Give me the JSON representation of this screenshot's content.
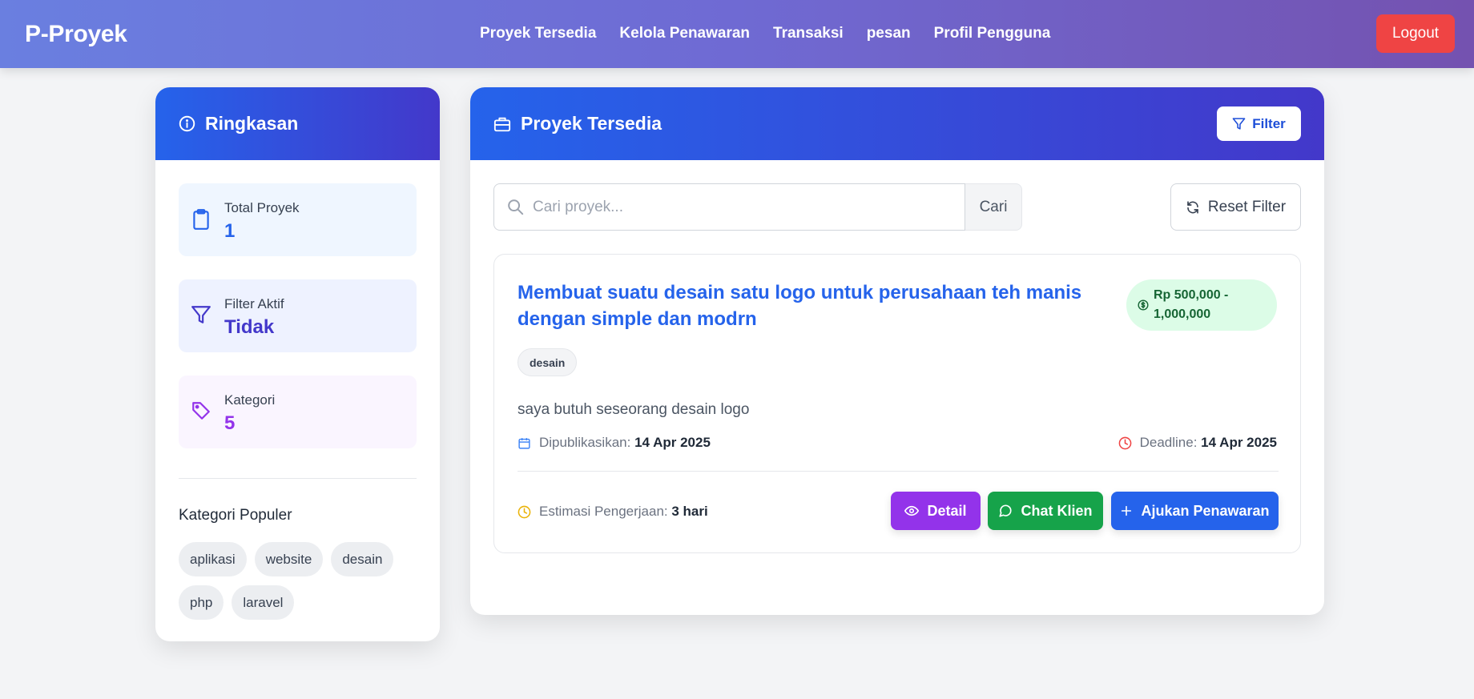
{
  "navbar": {
    "brand": "P-Proyek",
    "links": [
      "Proyek Tersedia",
      "Kelola Penawaran",
      "Transaksi",
      "pesan",
      "Profil Pengguna"
    ],
    "logout_label": "Logout"
  },
  "summary": {
    "title": "Ringkasan",
    "stats": [
      {
        "label": "Total Proyek",
        "value": "1",
        "color": "#2563eb",
        "bg": "#eff6ff",
        "icon": "clipboard-icon"
      },
      {
        "label": "Filter Aktif",
        "value": "Tidak",
        "color": "#4338ca",
        "bg": "#eef2ff",
        "icon": "filter-icon"
      },
      {
        "label": "Kategori",
        "value": "5",
        "color": "#9333ea",
        "bg": "#faf5ff",
        "icon": "tag-icon"
      }
    ],
    "popular_title": "Kategori Populer",
    "categories": [
      "aplikasi",
      "website",
      "desain",
      "php",
      "laravel"
    ]
  },
  "main": {
    "title": "Proyek Tersedia",
    "filter_label": "Filter",
    "search": {
      "placeholder": "Cari proyek...",
      "value": "",
      "button_label": "Cari"
    },
    "reset_label": "Reset Filter",
    "project": {
      "title": "Membuat suatu desain satu logo untuk perusahaan teh manis dengan simple dan modrn",
      "budget": "Rp 500,000 - 1,000,000",
      "tag": "desain",
      "description": "saya butuh seseorang desain logo",
      "published_label": "Dipublikasikan:",
      "published_date": "14 Apr 2025",
      "deadline_label": "Deadline:",
      "deadline_date": "14 Apr 2025",
      "estimate_label": "Estimasi Pengerjaan:",
      "estimate_value": "3 hari",
      "detail_label": "Detail",
      "chat_label": "Chat Klien",
      "offer_label": "Ajukan Penawaran"
    }
  },
  "colors": {
    "accent": "#2563eb",
    "danger": "#ef4444",
    "success": "#16a34a",
    "purple": "#9333ea"
  }
}
